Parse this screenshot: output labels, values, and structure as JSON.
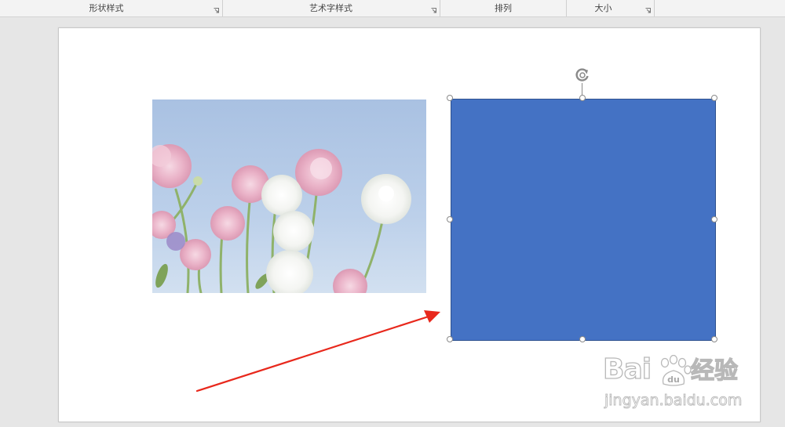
{
  "ribbon": {
    "groups": [
      {
        "label": "形状样式",
        "has_launcher": true
      },
      {
        "label": "艺术字样式",
        "has_launcher": true
      },
      {
        "label": "排列",
        "has_launcher": false
      },
      {
        "label": "大小",
        "has_launcher": true
      }
    ]
  },
  "slide": {
    "photo": {
      "subject": "pink and white ranunculus flowers against a pale blue sky"
    },
    "shape": {
      "type": "rectangle",
      "fill": "#4472c4",
      "outline": "#2f528f",
      "selected": true
    },
    "annotation_arrow": {
      "color": "#e8281c",
      "icon": "red-arrow-icon"
    }
  },
  "watermark": {
    "logo": "Bai",
    "logo2": "du",
    "cn": "经验",
    "url": "jingyan.baidu.com"
  },
  "colors": {
    "ribbon_bg": "#f3f3f3",
    "workspace_bg": "#e6e6e6",
    "slide_bg": "#ffffff",
    "shape_fill": "#4472c4",
    "arrow": "#e8281c"
  }
}
